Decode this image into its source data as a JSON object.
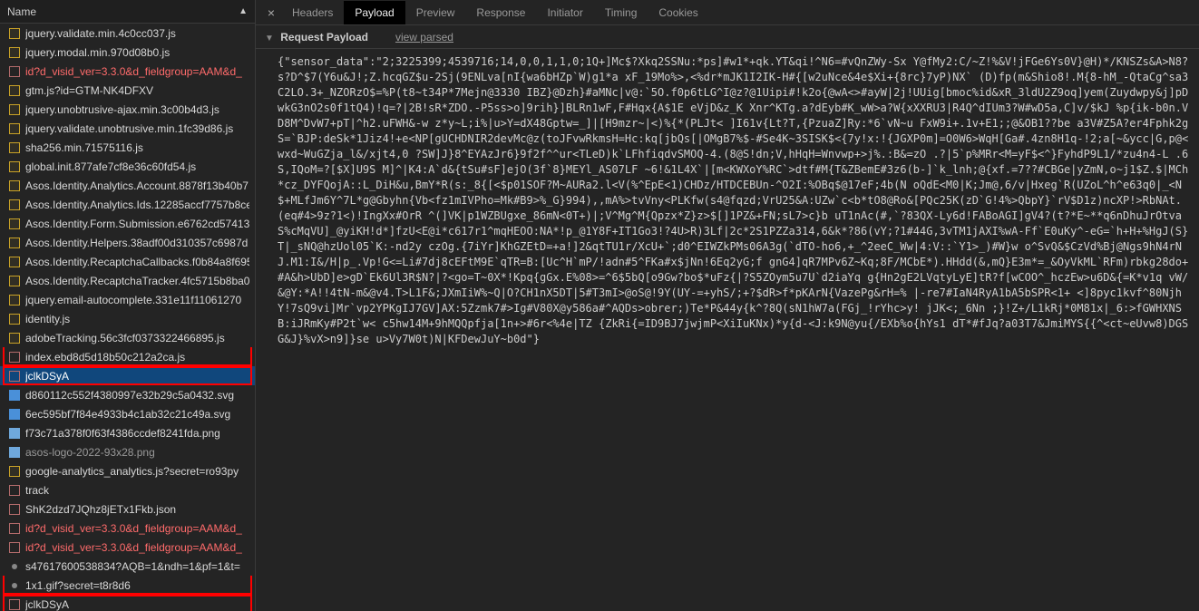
{
  "left": {
    "header": "Name",
    "rows": [
      {
        "icon": "js",
        "name": "jquery.validate.min.4c0cc037.js",
        "interact": true
      },
      {
        "icon": "js",
        "name": "jquery.modal.min.970d08b0.js",
        "interact": true
      },
      {
        "icon": "xhr",
        "name": "id?d_visid_ver=3.3.0&d_fieldgroup=AAM&d_",
        "red": true,
        "interact": true
      },
      {
        "icon": "js",
        "name": "gtm.js?id=GTM-NK4DFXV",
        "interact": true
      },
      {
        "icon": "js",
        "name": "jquery.unobtrusive-ajax.min.3c00b4d3.js",
        "interact": true
      },
      {
        "icon": "js",
        "name": "jquery.validate.unobtrusive.min.1fc39d86.js",
        "interact": true
      },
      {
        "icon": "js",
        "name": "sha256.min.71575116.js",
        "interact": true
      },
      {
        "icon": "js",
        "name": "global.init.877afe7cf8e36c60fd54.js",
        "interact": true
      },
      {
        "icon": "js",
        "name": "Asos.Identity.Analytics.Account.8878f13b40b7",
        "interact": true
      },
      {
        "icon": "js",
        "name": "Asos.Identity.Analytics.Ids.12285accf7757b8ce",
        "interact": true
      },
      {
        "icon": "js",
        "name": "Asos.Identity.Form.Submission.e6762cd57413",
        "interact": true
      },
      {
        "icon": "js",
        "name": "Asos.Identity.Helpers.38adf00d310357c6987d",
        "interact": true
      },
      {
        "icon": "js",
        "name": "Asos.Identity.RecaptchaCallbacks.f0b84a8f695",
        "interact": true
      },
      {
        "icon": "js",
        "name": "Asos.Identity.RecaptchaTracker.4fc5715b8ba0",
        "interact": true
      },
      {
        "icon": "js",
        "name": "jquery.email-autocomplete.331e11f11061270",
        "interact": true
      },
      {
        "icon": "js",
        "name": "identity.js",
        "interact": true
      },
      {
        "icon": "js",
        "name": "adobeTracking.56c3fcf0373322466895.js",
        "interact": true
      },
      {
        "icon": "xhr",
        "name": "index.ebd8d5d18b50c212a2ca.js",
        "interact": true,
        "redbox_bottom": true
      },
      {
        "icon": "xhr",
        "name": "jclkDSyA",
        "selected": true,
        "redbox": true,
        "interact": true
      },
      {
        "icon": "svg",
        "name": "d860112c552f4380997e32b29c5a0432.svg",
        "interact": true
      },
      {
        "icon": "svg",
        "name": "6ec595bf7f84e4933b4c1ab32c21c49a.svg",
        "interact": true
      },
      {
        "icon": "png",
        "name": "f73c71a378f0f63f4386ccdef8241fda.png",
        "interact": true
      },
      {
        "icon": "png",
        "name": "asos-logo-2022-93x28.png",
        "faint": true,
        "interact": true
      },
      {
        "icon": "js",
        "name": "google-analytics_analytics.js?secret=ro93py",
        "interact": true
      },
      {
        "icon": "xhr",
        "name": "track",
        "interact": true
      },
      {
        "icon": "xhr",
        "name": "ShK2dzd7JQhz8jETx1Fkb.json",
        "interact": true
      },
      {
        "icon": "xhr",
        "name": "id?d_visid_ver=3.3.0&d_fieldgroup=AAM&d_",
        "red": true,
        "interact": true
      },
      {
        "icon": "xhr",
        "name": "id?d_visid_ver=3.3.0&d_fieldgroup=AAM&d_",
        "red": true,
        "interact": true
      },
      {
        "icon": "dot",
        "name": "s47617600538834?AQB=1&ndh=1&pf=1&t=",
        "interact": true
      },
      {
        "icon": "dot",
        "name": "1x1.gif?secret=t8r8d6",
        "interact": true,
        "redbox_bottom": true
      },
      {
        "icon": "xhr",
        "name": "jclkDSyA",
        "redbox": true,
        "interact": true
      }
    ]
  },
  "tabs": {
    "close": "×",
    "items": [
      {
        "label": "Headers",
        "active": false
      },
      {
        "label": "Payload",
        "active": true
      },
      {
        "label": "Preview",
        "active": false
      },
      {
        "label": "Response",
        "active": false
      },
      {
        "label": "Initiator",
        "active": false
      },
      {
        "label": "Timing",
        "active": false
      },
      {
        "label": "Cookies",
        "active": false
      }
    ]
  },
  "payload": {
    "section_label": "Request Payload",
    "view_parsed": "view parsed",
    "body": "{\"sensor_data\":\"2;3225399;4539716;14,0,0,1,1,0;1Q+]Mc$?Xkq2SSNu:*ps]#w1*+qk.YT&qi!^N6=#vQnZWy-Sx Y@fMy2:C/~Z!%&V!jFGe6Ys0V}@H)*/KNSZs&A>N8?s?D^$7(Y6u&J!;Z.hcqGZ$u-2Sj(9ENLva[nI{wa6bHZp`W)g1*a xF_19Mo%>,<%dr*mJK1I2IK-H#{[w2uNce&4e$Xi+{8rc}7yP)NX` (D)fp(m&Shio8!.M{8-hM_-QtaCg^sa3C2LO.3+_NZORzO$=%P(t8~t34P*7Mejn@3330 IBZ}@Dzh}#aMNc|v@:`5O.f0p6tLG^I@z?@1Uipi#!k2o{@wA<>#ayW|2j!UUig[bmoc%id&xR_3ldU2Z9oq]yem(Zuydwpy&j]pDwkG3nO2s0f1tQ4)!q=?|2B!sR*ZDO.-P5ss>o]9rih}]BLRn1wF,F#Hqx{A$1E eVjD&z_K Xnr^KTg.a?dEyb#K_wW>a?W{xXXRU3|R4Q^dIUm3?W#wD5a,C]v/$kJ %p{ik-b0n.VD8M^DvW7+pT|^h2.uFWH&-w z*y~L;i%|u>Y=dX48Gptw=_]|[H9mzr~|<)%{*(PLJt< ]I61v{Lt?T,{PzuaZ]Ry:*6`vN~u FxW9i+.1v+E1;;@&OB1??be a3V#Z5A?er4Fphk2gS=`BJP:deSk*1Jiz4!+e<NP[gUCHDNIR2devMc@z(toJFvwRkmsH=Hc:kq[jbQs[|OMgB7%$-#Se4K~3SISK$<{7y!x:!{JGXP0m]=O0W6>WqH[Ga#.4zn8H1q-!2;a[~&ycc|G,p@<wxd~WuGZja_l&/xjt4,0 ?SW]J}8^EYAzJr6}9f2f^^ur<TLeD)k`LFhfiqdvSMOQ-4.(8@S!dn;V,hHqH=Wnvwp+>j%.:B&=zO .?|5`p%MRr<M=yF$<^}FyhdP9L1/*zu4n4-L .6S,IQoM=?[$X]U9S M]^|K4:A`d&{tSu#sF]ejO(3f`8}MEYl_AS07LF ~6!&1L4X`|[m<KWXoY%RC`>dtf#M{T&ZBemE#3z6(b-]`k_lnh;@{xf.=7??#CBGe|yZmN,o~j1$Z.$|MCh*cz_DYFQojA::L_DiH&u,BmY*R(s:_8{[<$p01SOF?M~AURa2.l<V(%^EpE<1)CHDz/HTDCEBUn-^O2I:%OBq$@17eF;4b(N oQdE<M0|K;Jm@,6/v|Hxeg`R(UZoL^h^e63q0|_<N$+MLfJm6Y^7L*g@Gbyhn{Vb<fz1mIVPho=Mk#B9>%_G}994),,mA%>tvVny<PLKfw(s4@fqzd;VrU25&A:UZw`c<b*tO8@Ro&[PQc25K(zD`G!4%>QbpY}`rV$D1z)ncXP!>RbNAt.(eq#4>9z?1<)!IngXx#OrR ^(]VK|p1WZBUgxe_86mN<0T+)|;V^Mg^M{Qpzx*Z}z>$[]1PZ&+FN;sL7>c}b uT1nAc(#,`?83QX-Ly6d!FABoAGI]gV4?(t?*E~**q6nDhuJrOtvaS%cMqVU]_@yiKH!d*]fzU<E@i*c617r1^mqHEOO:NA*!p_@1Y8F+IT1Go3!?4U>R)3Lf|2c*2S1PZZa314,6&k*?86(vY;?1#44G,3vTM1jAXI%wA-Ff`E0uKy^-eG=`h+H+%HgJ(S}T|_sNQ@hzUol05`K:-nd2y czOg.{7iYr]KhGZEtD=+a!]2&qtTU1r/XcU+`;d0^EIWZkPMs06A3g(`dTO-ho6,+_^2eeC_Ww|4:V::`Y1>_)#W}w o^SvQ&$CzVd%Bj@Ngs9hN4rNJ.M1:I&/H|p_.Vp!G<=Li#7dj8cEFtM9E`qTR=B:[Uc^H`mP/!adn#5^FKa#x$jNn!6Eq2yG;f gnG4]qR7MPv6Z~Kq;8F/MCbE*).HHdd(&,mQ}E3m*=_&OyVkML`RFm)rbkg28do+#A&h>UbD]e>gD`Ek6Ul3R$N?|?<go=T~0X*!Kpq{gGx.E%08>=^6$5bQ[o9Gw?bo$*uFz{|?S5ZOym5u7U`d2iaYq g{Hn2gE2LVqtyLyE]tR?f[wCOO^_hczEw>u6D&{=K*v1q vW/&@Y:*A!!4tN-m&@v4.T>L1F&;JXmIiW%~Q|O?CH1nX5DT|5#T3mI>@oS@!9Y(UY-=+yhS/;+?$dR>f*pKArN{VazePg&rH=% |-re7#IaN4RyA1bA5bSPR<1+ <]8pyc1kvf^80NjhY!7sQ9vi]Mr`vp2YPKgIJ7GV]AX:5Zzmk7#>Ig#V80X@y586a#^AQDs>obrer;)Te*P&44y{k^?8Q(sN1hW7a(FGj_!rYhc>y! jJK<;_6Nn ;}!Z+/L1kRj*0M81x|_6:>fGWHXNSB:iJRmKy#P2t`w< c5hw14M+9hMQQpfja[1n+>#6r<%4e|TZ {ZkRi{=ID9BJ7jwjmP<XiIuKNx)*y{d-<J:k9N@yu{/EXb%o{hYs1 dT*#fJq?a03T7&JmiMYS{{^<ct~eUvw8)DGSG&J}%vX>n9]}se u>Vy7W0t)N|KFDewJuY~b0d\"}"
  }
}
